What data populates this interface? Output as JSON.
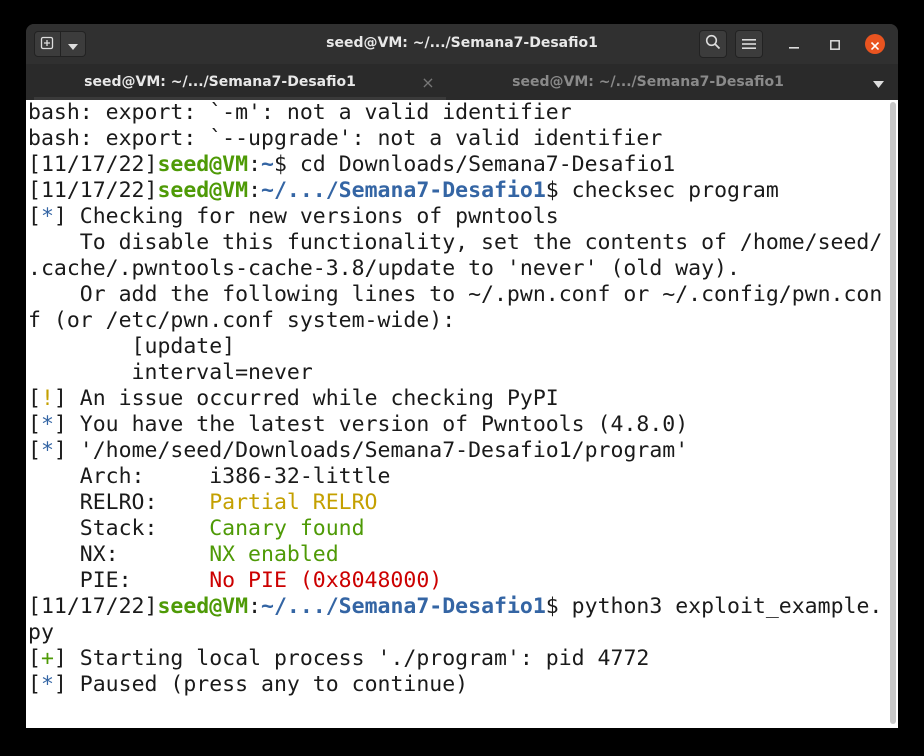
{
  "window": {
    "title": "seed@VM: ~/.../Semana7-Desafio1"
  },
  "titlebar": {
    "new_tab_icon": "new-tab-icon",
    "menu_dropdown_icon": "chevron-down-icon",
    "search_icon": "search-icon",
    "hamburger_icon": "hamburger-menu-icon",
    "minimize_icon": "minimize-icon",
    "maximize_icon": "maximize-icon",
    "close_icon": "close-icon",
    "close_color": "#e95420"
  },
  "tabs": [
    {
      "label": "seed@VM: ~/.../Semana7-Desafio1",
      "close": "×"
    },
    {
      "label": "seed@VM: ~/.../Semana7-Desafio1",
      "close": "×"
    }
  ],
  "colors": {
    "prompt_user": "#4e9a06",
    "prompt_path": "#3465a4",
    "warning": "#c4a000",
    "error": "#cc0000",
    "success": "#4e9a06"
  },
  "terminal": {
    "lines": [
      [
        {
          "t": "bash: export: `-m': not a valid identifier"
        }
      ],
      [
        {
          "t": "bash: export: `--upgrade': not a valid identifier"
        }
      ],
      [
        {
          "t": "[11/17/22]"
        },
        {
          "t": "seed@VM",
          "c": "green"
        },
        {
          "t": ":"
        },
        {
          "t": "~",
          "c": "blue"
        },
        {
          "t": "$ cd Downloads/Semana7-Desafio1"
        }
      ],
      [
        {
          "t": "[11/17/22]"
        },
        {
          "t": "seed@VM",
          "c": "green"
        },
        {
          "t": ":"
        },
        {
          "t": "~/.../Semana7-Desafio1",
          "c": "blue"
        },
        {
          "t": "$ checksec program"
        }
      ],
      [
        {
          "t": "["
        },
        {
          "t": "*",
          "c": "bblue"
        },
        {
          "t": "] Checking for new versions of pwntools"
        }
      ],
      [
        {
          "t": "    To disable this functionality, set the contents of /home/seed/"
        }
      ],
      [
        {
          "t": ".cache/.pwntools-cache-3.8/update to 'never' (old way)."
        }
      ],
      [
        {
          "t": "    Or add the following lines to ~/.pwn.conf or ~/.config/pwn.con"
        }
      ],
      [
        {
          "t": "f (or /etc/pwn.conf system-wide):"
        }
      ],
      [
        {
          "t": "        [update]"
        }
      ],
      [
        {
          "t": "        interval=never"
        }
      ],
      [
        {
          "t": "["
        },
        {
          "t": "!",
          "c": "yellow"
        },
        {
          "t": "] An issue occurred while checking PyPI"
        }
      ],
      [
        {
          "t": "["
        },
        {
          "t": "*",
          "c": "bblue"
        },
        {
          "t": "] You have the latest version of Pwntools (4.8.0)"
        }
      ],
      [
        {
          "t": "["
        },
        {
          "t": "*",
          "c": "bblue"
        },
        {
          "t": "] '/home/seed/Downloads/Semana7-Desafio1/program'"
        }
      ],
      [
        {
          "t": "    Arch:     i386-32-little"
        }
      ],
      [
        {
          "t": "    RELRO:    "
        },
        {
          "t": "Partial RELRO",
          "c": "yellow"
        }
      ],
      [
        {
          "t": "    Stack:    "
        },
        {
          "t": "Canary found",
          "c": "success"
        }
      ],
      [
        {
          "t": "    NX:       "
        },
        {
          "t": "NX enabled",
          "c": "success"
        }
      ],
      [
        {
          "t": "    PIE:      "
        },
        {
          "t": "No PIE (0x8048000)",
          "c": "red"
        }
      ],
      [
        {
          "t": "[11/17/22]"
        },
        {
          "t": "seed@VM",
          "c": "green"
        },
        {
          "t": ":"
        },
        {
          "t": "~/.../Semana7-Desafio1",
          "c": "blue"
        },
        {
          "t": "$ python3 exploit_example."
        }
      ],
      [
        {
          "t": "py"
        }
      ],
      [
        {
          "t": "["
        },
        {
          "t": "+",
          "c": "success"
        },
        {
          "t": "] Starting local process './program': pid 4772"
        }
      ],
      [
        {
          "t": "["
        },
        {
          "t": "*",
          "c": "bblue"
        },
        {
          "t": "] Paused (press any to continue)"
        }
      ]
    ]
  }
}
